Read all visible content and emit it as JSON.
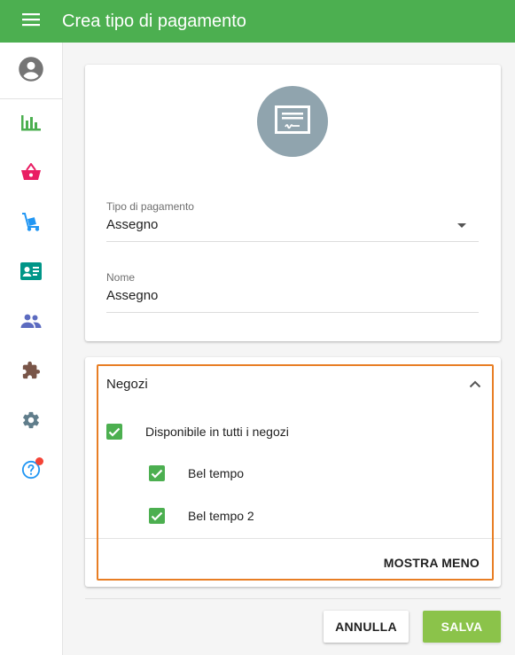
{
  "appbar": {
    "title": "Crea tipo di pagamento",
    "menu_icon": "menu-icon",
    "color": "#4caf50"
  },
  "sidebar": {
    "items": [
      {
        "name": "account",
        "icon": "account-circle-icon",
        "color": "#757575"
      },
      {
        "name": "statistics",
        "icon": "bar-chart-icon",
        "color": "#4caf50"
      },
      {
        "name": "sales",
        "icon": "basket-icon",
        "color": "#e91e63"
      },
      {
        "name": "products",
        "icon": "hand-truck-icon",
        "color": "#2196f3"
      },
      {
        "name": "customers",
        "icon": "contact-card-icon",
        "color": "#009688"
      },
      {
        "name": "employees",
        "icon": "people-icon",
        "color": "#5c6bc0"
      },
      {
        "name": "extensions",
        "icon": "puzzle-icon",
        "color": "#795548"
      },
      {
        "name": "settings",
        "icon": "gear-icon",
        "color": "#607d8b"
      },
      {
        "name": "help",
        "icon": "help-icon",
        "color": "#2196f3",
        "badge": true
      }
    ]
  },
  "form": {
    "header_icon": "check-document-icon",
    "payment_type": {
      "label": "Tipo di pagamento",
      "value": "Assegno"
    },
    "name": {
      "label": "Nome",
      "value": "Assegno"
    }
  },
  "stores": {
    "title": "Negozi",
    "all_stores": {
      "label": "Disponibile in tutti i negozi",
      "checked": true
    },
    "items": [
      {
        "label": "Bel tempo",
        "checked": true
      },
      {
        "label": "Bel tempo 2",
        "checked": true
      }
    ],
    "show_less": "MOSTRA MENO"
  },
  "actions": {
    "cancel": "ANNULLA",
    "save": "SALVA",
    "save_color": "#8bc34a"
  }
}
